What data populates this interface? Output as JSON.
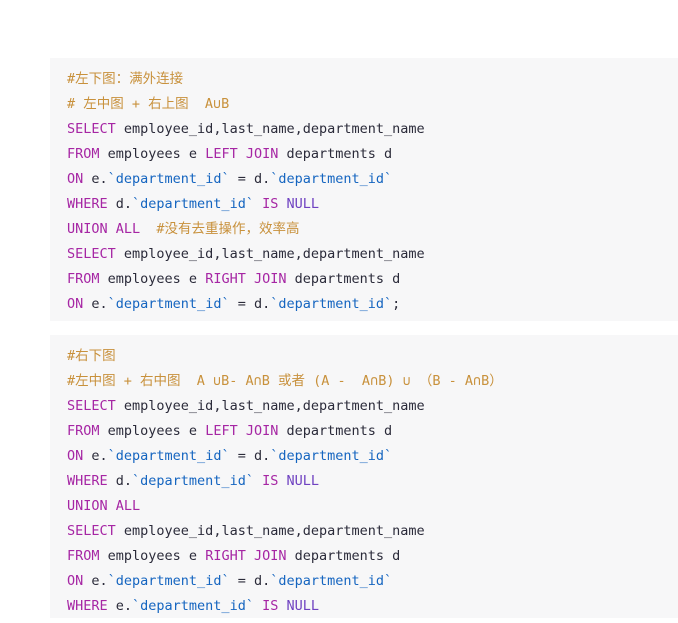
{
  "page": {
    "background": "#ffffff",
    "code_background": "#f7f7f8"
  },
  "colors": {
    "comment": "#c8913c",
    "keyword": "#a626a4",
    "null_keyword": "#6f42c1",
    "identifier": "#2b2b3a",
    "string": "#1565c0"
  },
  "blocks": [
    {
      "name": "sql-snippet-full-outer-join",
      "lines": [
        [
          {
            "t": "#左下图：满外连接",
            "c": "comment"
          }
        ],
        [
          {
            "t": "# 左中图 + 右上图  A∪B",
            "c": "comment"
          }
        ],
        [
          {
            "t": "SELECT",
            "c": "keyword"
          },
          {
            "t": " employee_id,last_name,department_name",
            "c": "identifier"
          }
        ],
        [
          {
            "t": "FROM",
            "c": "keyword"
          },
          {
            "t": " employees e ",
            "c": "identifier"
          },
          {
            "t": "LEFT JOIN",
            "c": "keyword"
          },
          {
            "t": " departments d",
            "c": "identifier"
          }
        ],
        [
          {
            "t": "ON",
            "c": "keyword"
          },
          {
            "t": " e.",
            "c": "identifier"
          },
          {
            "t": "`department_id`",
            "c": "string"
          },
          {
            "t": " = ",
            "c": "identifier"
          },
          {
            "t": "d.",
            "c": "identifier"
          },
          {
            "t": "`department_id`",
            "c": "string"
          }
        ],
        [
          {
            "t": "WHERE",
            "c": "keyword"
          },
          {
            "t": " d.",
            "c": "identifier"
          },
          {
            "t": "`department_id`",
            "c": "string"
          },
          {
            "t": " ",
            "c": "identifier"
          },
          {
            "t": "IS",
            "c": "keyword"
          },
          {
            "t": " ",
            "c": "identifier"
          },
          {
            "t": "NULL",
            "c": "null_keyword"
          }
        ],
        [
          {
            "t": "UNION ALL",
            "c": "keyword"
          },
          {
            "t": "  ",
            "c": "identifier"
          },
          {
            "t": "#没有去重操作，效率高",
            "c": "comment"
          }
        ],
        [
          {
            "t": "SELECT",
            "c": "keyword"
          },
          {
            "t": " employee_id,last_name,department_name",
            "c": "identifier"
          }
        ],
        [
          {
            "t": "FROM",
            "c": "keyword"
          },
          {
            "t": " employees e ",
            "c": "identifier"
          },
          {
            "t": "RIGHT JOIN",
            "c": "keyword"
          },
          {
            "t": " departments d",
            "c": "identifier"
          }
        ],
        [
          {
            "t": "ON",
            "c": "keyword"
          },
          {
            "t": " e.",
            "c": "identifier"
          },
          {
            "t": "`department_id`",
            "c": "string"
          },
          {
            "t": " = ",
            "c": "identifier"
          },
          {
            "t": "d.",
            "c": "identifier"
          },
          {
            "t": "`department_id`",
            "c": "string"
          },
          {
            "t": ";",
            "c": "identifier"
          }
        ]
      ]
    },
    {
      "name": "sql-snippet-symmetric-difference",
      "lines": [
        [
          {
            "t": "#右下图",
            "c": "comment"
          }
        ],
        [
          {
            "t": "#左中图 + 右中图  A ∪B- A∩B 或者 (A -  A∩B) ∪ （B - A∩B）",
            "c": "comment"
          }
        ],
        [
          {
            "t": "SELECT",
            "c": "keyword"
          },
          {
            "t": " employee_id,last_name,department_name",
            "c": "identifier"
          }
        ],
        [
          {
            "t": "FROM",
            "c": "keyword"
          },
          {
            "t": " employees e ",
            "c": "identifier"
          },
          {
            "t": "LEFT JOIN",
            "c": "keyword"
          },
          {
            "t": " departments d",
            "c": "identifier"
          }
        ],
        [
          {
            "t": "ON",
            "c": "keyword"
          },
          {
            "t": " e.",
            "c": "identifier"
          },
          {
            "t": "`department_id`",
            "c": "string"
          },
          {
            "t": " = ",
            "c": "identifier"
          },
          {
            "t": "d.",
            "c": "identifier"
          },
          {
            "t": "`department_id`",
            "c": "string"
          }
        ],
        [
          {
            "t": "WHERE",
            "c": "keyword"
          },
          {
            "t": " d.",
            "c": "identifier"
          },
          {
            "t": "`department_id`",
            "c": "string"
          },
          {
            "t": " ",
            "c": "identifier"
          },
          {
            "t": "IS",
            "c": "keyword"
          },
          {
            "t": " ",
            "c": "identifier"
          },
          {
            "t": "NULL",
            "c": "null_keyword"
          }
        ],
        [
          {
            "t": "UNION ALL",
            "c": "keyword"
          }
        ],
        [
          {
            "t": "SELECT",
            "c": "keyword"
          },
          {
            "t": " employee_id,last_name,department_name",
            "c": "identifier"
          }
        ],
        [
          {
            "t": "FROM",
            "c": "keyword"
          },
          {
            "t": " employees e ",
            "c": "identifier"
          },
          {
            "t": "RIGHT JOIN",
            "c": "keyword"
          },
          {
            "t": " departments d",
            "c": "identifier"
          }
        ],
        [
          {
            "t": "ON",
            "c": "keyword"
          },
          {
            "t": " e.",
            "c": "identifier"
          },
          {
            "t": "`department_id`",
            "c": "string"
          },
          {
            "t": " = ",
            "c": "identifier"
          },
          {
            "t": "d.",
            "c": "identifier"
          },
          {
            "t": "`department_id`",
            "c": "string"
          }
        ],
        [
          {
            "t": "WHERE",
            "c": "keyword"
          },
          {
            "t": " e.",
            "c": "identifier"
          },
          {
            "t": "`department_id`",
            "c": "string"
          },
          {
            "t": " ",
            "c": "identifier"
          },
          {
            "t": "IS",
            "c": "keyword"
          },
          {
            "t": " ",
            "c": "identifier"
          },
          {
            "t": "NULL",
            "c": "null_keyword"
          }
        ]
      ]
    }
  ]
}
